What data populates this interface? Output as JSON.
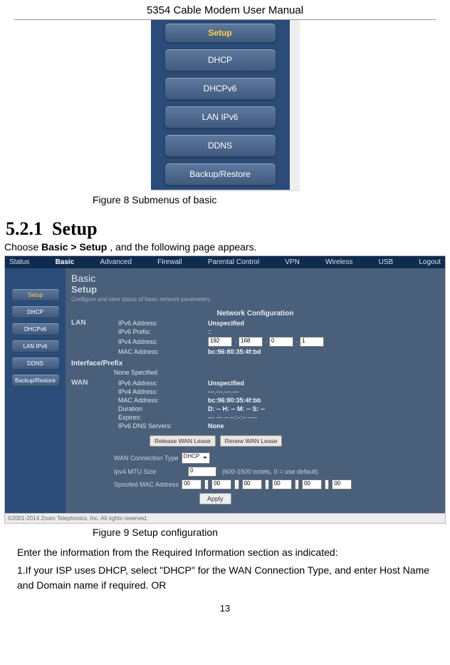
{
  "doc_title": "5354 Cable Modem User Manual",
  "submenu": {
    "items": [
      "Setup",
      "DHCP",
      "DHCPv6",
      "LAN IPv6",
      "DDNS",
      "Backup/Restore"
    ],
    "active": 0
  },
  "fig8_caption": "Figure 8 Submenus of basic",
  "section": {
    "number": "5.2.1",
    "title": "Setup"
  },
  "choose_line": {
    "prefix": "Choose ",
    "bold": "Basic > Setup",
    "suffix": " , and the following page appears."
  },
  "fig9": {
    "topnav": [
      "Status",
      "Basic",
      "Advanced",
      "Firewall",
      "Parental Control",
      "VPN",
      "Wireless",
      "USB",
      "Logout"
    ],
    "topnav_active": 1,
    "side": [
      "Setup",
      "DHCP",
      "DHCPv6",
      "LAN IPv6",
      "DDNS",
      "Backup/Restore"
    ],
    "side_active": 0,
    "heading_title": "Basic",
    "heading_sub": "Setup",
    "heading_desc": "Configure and view status of basic network parameters.",
    "section_netconf": "Network Configuration",
    "lan_label": "LAN",
    "lan": {
      "ipv6_addr_label": "IPv6 Address:",
      "ipv6_addr_value": "Unspecified",
      "ipv6_prefix_label": "IPv6 Prefix:",
      "ipv6_prefix_value": "::",
      "ipv4_addr_label": "IPv4 Address:",
      "ipv4_octets": [
        "192",
        "168",
        "0",
        "1"
      ],
      "mac_label": "MAC Address:",
      "mac_value": "bc:96:80:35:4f:bd"
    },
    "interface_prefix_label": "Interface/Prefix",
    "none_specified": "None Specified",
    "wan_label": "WAN",
    "wan": {
      "ipv6_addr_label": "IPv6 Address:",
      "ipv6_addr_value": "Unspecified",
      "ipv4_addr_label": "IPv4 Address:",
      "ipv4_addr_value": "---.---.---.---",
      "mac_label": "MAC Address:",
      "mac_value": "bc:96:80:35:4f:bb",
      "duration_label": "Duration",
      "duration_value": "D: -- H: -- M: -- S: --",
      "expires_label": "Expires:",
      "expires_value": "--- --- -- --:--:-- ----",
      "dns_label": "IPv6 DNS Servers:",
      "dns_value": "None"
    },
    "lease_release": "Release WAN Lease",
    "lease_renew": "Renew WAN Lease",
    "wan_conn_type_label": "WAN Connection Type",
    "wan_conn_type_value": "DHCP",
    "mtu_label": "Ipv4 MTU Size",
    "mtu_value": "0",
    "mtu_hint": "(600-1500 octets, 0 = use default)",
    "spoof_label": "Spoofed MAC Address",
    "spoof_octets": [
      "00",
      "00",
      "00",
      "00",
      "00",
      "00"
    ],
    "apply": "Apply",
    "copyright": "©2001-2014 Zoom Telephonics, Inc. All rights reserved."
  },
  "fig9_caption": "Figure 9 Setup configuration",
  "body": {
    "line1": "Enter the information from the Required Information section as indicated:",
    "line2": "1.If your ISP uses DHCP, select \"DHCP\" for the WAN Connection Type, and enter Host Name and Domain name if required. OR"
  },
  "page_number": "13"
}
